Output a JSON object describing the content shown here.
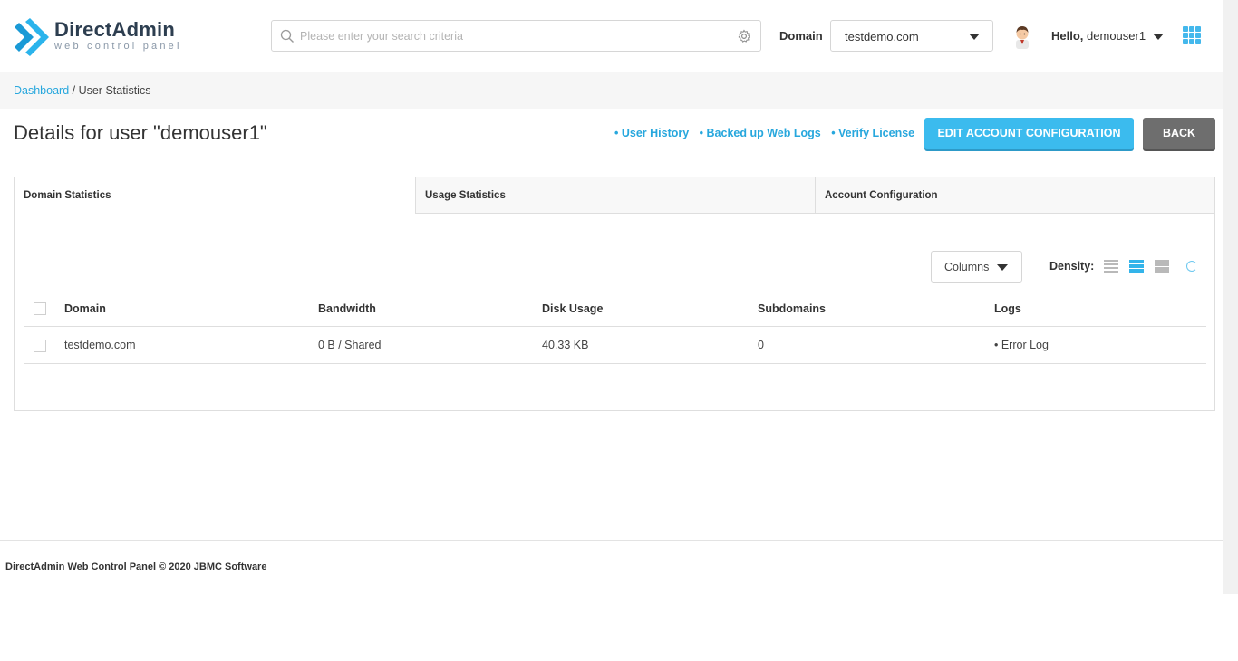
{
  "brand": {
    "title": "DirectAdmin",
    "subtitle": "web control panel"
  },
  "header": {
    "search_placeholder": "Please enter your search criteria",
    "domain_label": "Domain",
    "domain_value": "testdemo.com",
    "hello_prefix": "Hello,",
    "username": "demouser1"
  },
  "breadcrumb": {
    "link": "Dashboard",
    "separator": " / ",
    "current": "User Statistics"
  },
  "page": {
    "title": "Details for user \"demouser1\"",
    "links": [
      "• User History",
      "• Backed up Web Logs",
      "• Verify License"
    ],
    "edit_button": "EDIT ACCOUNT CONFIGURATION",
    "back_button": "BACK"
  },
  "tabs": [
    "Domain Statistics",
    "Usage Statistics",
    "Account Configuration"
  ],
  "toolbar": {
    "columns_label": "Columns",
    "density_label": "Density:",
    "active_density": "medium"
  },
  "table": {
    "headers": [
      "Domain",
      "Bandwidth",
      "Disk Usage",
      "Subdomains",
      "Logs"
    ],
    "rows": [
      [
        "testdemo.com",
        "0 B / Shared",
        "40.33 KB",
        "0",
        "• Error Log"
      ]
    ]
  },
  "footer": {
    "text": "DirectAdmin Web Control Panel © 2020 JBMC Software"
  },
  "colors": {
    "accent": "#3bbbee",
    "link": "#27a7dd",
    "back_button": "#6e6e6e",
    "brand_dark": "#2d3e50"
  }
}
